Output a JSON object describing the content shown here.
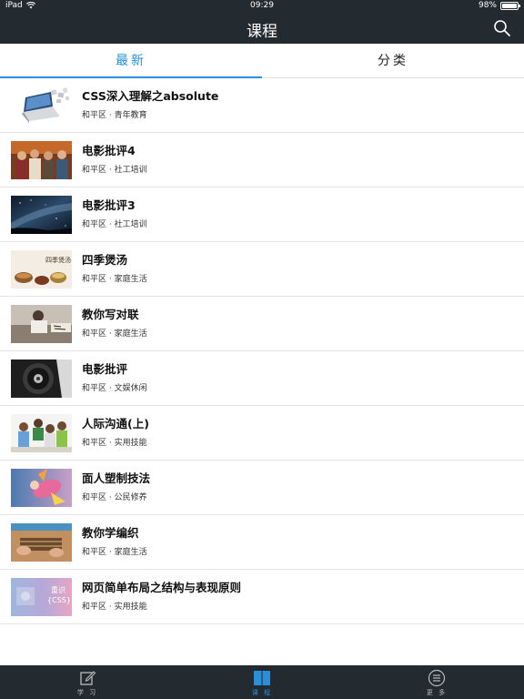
{
  "status_bar": {
    "device": "iPad",
    "time": "09:29",
    "battery": "98%",
    "battery_level": 0.98
  },
  "nav": {
    "title": "课程",
    "search_icon": "search-icon"
  },
  "tabs": [
    {
      "label": "最新",
      "active": true
    },
    {
      "label": "分类",
      "active": false
    }
  ],
  "courses": [
    {
      "title": "CSS深入理解之absolute",
      "subtitle": "和平区 · 青年教育",
      "thumb": "laptop-icon"
    },
    {
      "title": "电影批评4",
      "subtitle": "和平区 · 社工培训",
      "thumb": "people-photo"
    },
    {
      "title": "电影批评3",
      "subtitle": "和平区 · 社工培训",
      "thumb": "night-sky-photo"
    },
    {
      "title": "四季煲汤",
      "subtitle": "和平区 · 家庭生活",
      "thumb": "soup-photo"
    },
    {
      "title": "教你写对联",
      "subtitle": "和平区 · 家庭生活",
      "thumb": "calligraphy-photo"
    },
    {
      "title": "电影批评",
      "subtitle": "和平区 · 文娱休闲",
      "thumb": "film-reel-photo"
    },
    {
      "title": "人际沟通(上)",
      "subtitle": "和平区 · 实用技能",
      "thumb": "group-photo"
    },
    {
      "title": "面人塑制技法",
      "subtitle": "和平区 · 公民修养",
      "thumb": "dough-figure-photo"
    },
    {
      "title": "教你学编织",
      "subtitle": "和平区 · 家庭生活",
      "thumb": "weaving-photo"
    },
    {
      "title": "网页简单布局之结构与表现原则",
      "subtitle": "和平区 · 实用技能",
      "thumb": "css-slide",
      "thumb_text": {
        "line1": "重识",
        "line2": "{CSS}"
      }
    }
  ],
  "bottom_tabs": [
    {
      "label": "学 习",
      "icon": "edit-icon",
      "active": false
    },
    {
      "label": "课 程",
      "icon": "book-icon",
      "active": true
    },
    {
      "label": "更 多",
      "icon": "menu-icon",
      "active": false
    }
  ],
  "colors": {
    "bar": "#232a30",
    "accent": "#2a8fd8"
  }
}
